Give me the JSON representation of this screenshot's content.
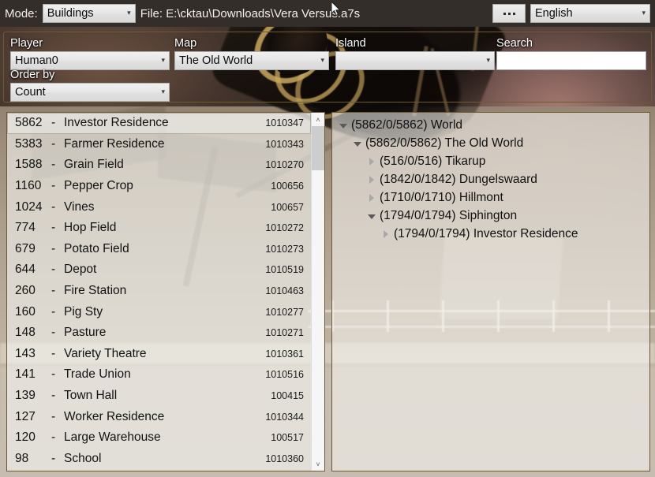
{
  "topbar": {
    "mode_label": "Mode:",
    "mode_value": "Buildings",
    "file_label": "File: E:\\cktau\\Downloads\\Vera Versus.a7s",
    "browse_button": "...",
    "language_value": "English"
  },
  "filters": {
    "player": {
      "label": "Player",
      "value": "Human0"
    },
    "map": {
      "label": "Map",
      "value": "The Old World"
    },
    "island": {
      "label": "Island",
      "value": ""
    },
    "search": {
      "label": "Search",
      "value": "",
      "placeholder": ""
    },
    "order_by": {
      "label": "Order by",
      "value": "Count"
    }
  },
  "list": {
    "rows": [
      {
        "count": "5862",
        "dash": "-",
        "name": "Investor Residence",
        "guid": "1010347",
        "selected": true
      },
      {
        "count": "5383",
        "dash": "-",
        "name": "Farmer Residence",
        "guid": "1010343",
        "selected": false
      },
      {
        "count": "1588",
        "dash": "-",
        "name": "Grain Field",
        "guid": "1010270",
        "selected": false
      },
      {
        "count": "1160",
        "dash": "-",
        "name": "Pepper Crop",
        "guid": "100656",
        "selected": false
      },
      {
        "count": "1024",
        "dash": "-",
        "name": "Vines",
        "guid": "100657",
        "selected": false
      },
      {
        "count": "774",
        "dash": "-",
        "name": "Hop Field",
        "guid": "1010272",
        "selected": false
      },
      {
        "count": "679",
        "dash": "-",
        "name": "Potato Field",
        "guid": "1010273",
        "selected": false
      },
      {
        "count": "644",
        "dash": "-",
        "name": "Depot",
        "guid": "1010519",
        "selected": false
      },
      {
        "count": "260",
        "dash": "-",
        "name": "Fire Station",
        "guid": "1010463",
        "selected": false
      },
      {
        "count": "160",
        "dash": "-",
        "name": "Pig Sty",
        "guid": "1010277",
        "selected": false
      },
      {
        "count": "148",
        "dash": "-",
        "name": "Pasture",
        "guid": "1010271",
        "selected": false
      },
      {
        "count": "143",
        "dash": "-",
        "name": "Variety Theatre",
        "guid": "1010361",
        "selected": false
      },
      {
        "count": "141",
        "dash": "-",
        "name": "Trade Union",
        "guid": "1010516",
        "selected": false
      },
      {
        "count": "139",
        "dash": "-",
        "name": "Town Hall",
        "guid": "100415",
        "selected": false
      },
      {
        "count": "127",
        "dash": "-",
        "name": "Worker Residence",
        "guid": "1010344",
        "selected": false
      },
      {
        "count": "120",
        "dash": "-",
        "name": "Large Warehouse",
        "guid": "100517",
        "selected": false
      },
      {
        "count": "98",
        "dash": "-",
        "name": "School",
        "guid": "1010360",
        "selected": false
      }
    ],
    "scroll_up_icon": "˄",
    "scroll_down_icon": "˅"
  },
  "tree": {
    "nodes": [
      {
        "label": "(5862/0/5862) World",
        "depth": 0,
        "state": "expanded"
      },
      {
        "label": "(5862/0/5862) The Old World",
        "depth": 1,
        "state": "expanded"
      },
      {
        "label": "(516/0/516) Tikarup",
        "depth": 2,
        "state": "collapsed"
      },
      {
        "label": "(1842/0/1842) Dungelswaard",
        "depth": 2,
        "state": "collapsed"
      },
      {
        "label": "(1710/0/1710) Hillmont",
        "depth": 2,
        "state": "collapsed"
      },
      {
        "label": "(1794/0/1794) Siphington",
        "depth": 2,
        "state": "expanded"
      },
      {
        "label": "(1794/0/1794) Investor Residence",
        "depth": 3,
        "state": "collapsed"
      }
    ]
  },
  "colors": {
    "topbar_bg": "#332e2a",
    "panel_border": "#6b5a34",
    "label_text": "#ffffff",
    "list_text": "#121212"
  }
}
